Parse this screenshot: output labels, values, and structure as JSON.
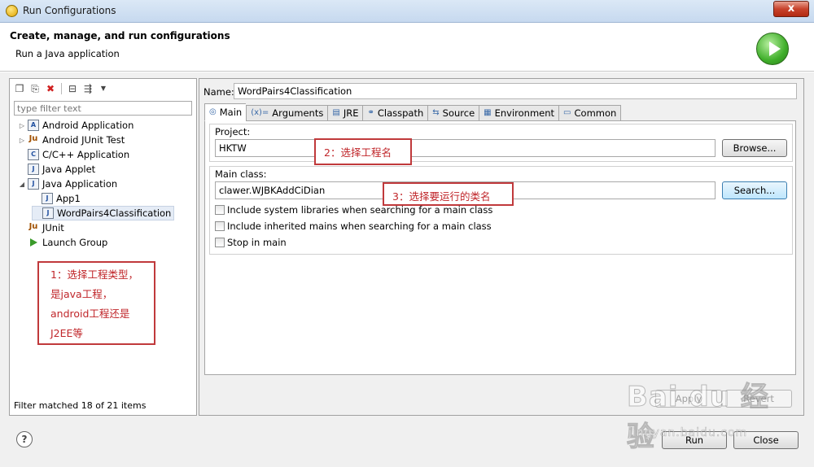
{
  "window": {
    "title": "Run Configurations",
    "close_label": "x"
  },
  "header": {
    "title": "Create, manage, and run configurations",
    "subtitle": "Run a Java application"
  },
  "left": {
    "filter_placeholder": "type filter text",
    "tree": [
      {
        "label": "Android Application",
        "icon": "A",
        "twisty": "▷"
      },
      {
        "label": "Android JUnit Test",
        "icon": "Ju",
        "twisty": "▷"
      },
      {
        "label": "C/C++ Application",
        "icon": "C",
        "twisty": ""
      },
      {
        "label": "Java Applet",
        "icon": "J",
        "twisty": ""
      },
      {
        "label": "Java Application",
        "icon": "J",
        "twisty": "◢"
      },
      {
        "label": "App1",
        "icon": "J",
        "twisty": ""
      },
      {
        "label": "WordPairs4Classification",
        "icon": "J",
        "twisty": ""
      },
      {
        "label": "JUnit",
        "icon": "Ju",
        "twisty": ""
      },
      {
        "label": "Launch Group",
        "icon": "",
        "twisty": ""
      }
    ],
    "matched": "Filter matched 18 of 21 items"
  },
  "annotations": {
    "a1_line1": "1：选择工程类型，",
    "a1_line2": "是java工程，",
    "a1_line3": "android工程还是",
    "a1_line4": "J2EE等",
    "a2": "2：选择工程名",
    "a3": "3：选择要运行的类名"
  },
  "right": {
    "name_label": "Name:",
    "name_value": "WordPairs4Classification",
    "tabs": [
      {
        "label": "Main",
        "icon": "◎"
      },
      {
        "label": "Arguments",
        "icon": "(x)="
      },
      {
        "label": "JRE",
        "icon": "▤"
      },
      {
        "label": "Classpath",
        "icon": "⚭"
      },
      {
        "label": "Source",
        "icon": "⇆"
      },
      {
        "label": "Environment",
        "icon": "▦"
      },
      {
        "label": "Common",
        "icon": "▭"
      }
    ],
    "project_label": "Project:",
    "project_value": "HKTW",
    "browse_label": "Browse...",
    "main_class_label": "Main class:",
    "main_class_value": "clawer.WJBKAddCiDian",
    "search_label": "Search...",
    "checks": [
      "Include system libraries when searching for a main class",
      "Include inherited mains when searching for a main class",
      "Stop in main"
    ],
    "apply_label": "Apply",
    "revert_label": "Revert"
  },
  "footer": {
    "run_label": "Run",
    "close_label": "Close",
    "help_label": "?"
  },
  "watermark": {
    "brand": "Bai du 经验",
    "url": "jingyan.baidu.com"
  },
  "colors": {
    "annotation": "#c0393b",
    "run_green": "#3fae2a"
  }
}
